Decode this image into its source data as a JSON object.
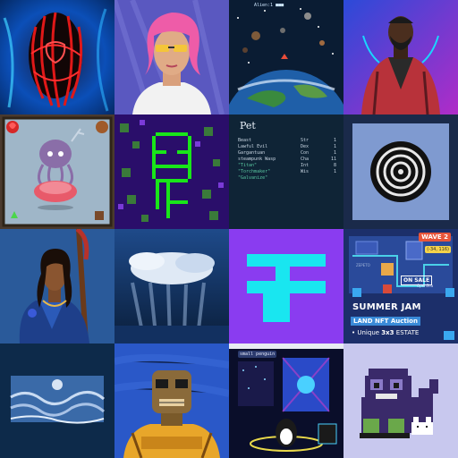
{
  "grid": {
    "tiles": [
      {
        "name": "red-figure-on-blue-artwork"
      },
      {
        "name": "pink-hair-woman-portrait"
      },
      {
        "name": "space-game-screenshot",
        "top_text": "Alien:1 ■■■"
      },
      {
        "name": "man-in-red-jacket-portrait"
      },
      {
        "name": "octopus-creature-card"
      },
      {
        "name": "green-pixel-face-artwork"
      },
      {
        "name": "pet-character-sheet",
        "pet": {
          "title": "Pet",
          "rows": [
            {
              "label": "Beast",
              "stat": "Str",
              "value": "1",
              "highlight": false
            },
            {
              "label": "Lawful Evil",
              "stat": "Dex",
              "value": "1",
              "highlight": false
            },
            {
              "label": "Gargantuan",
              "stat": "Con",
              "value": "1",
              "highlight": false
            },
            {
              "label": "steampunk Wasp",
              "stat": "Cha",
              "value": "11",
              "highlight": false
            },
            {
              "label": "\"Titan\"",
              "stat": "Int",
              "value": "8",
              "highlight": true
            },
            {
              "label": "\"Torchmaker\"",
              "stat": "Wis",
              "value": "1",
              "highlight": true
            },
            {
              "label": "\"Galvanize\"",
              "stat": "",
              "value": "",
              "highlight": true
            }
          ]
        }
      },
      {
        "name": "spiral-disc-artwork"
      },
      {
        "name": "woman-with-staff-illustration"
      },
      {
        "name": "cloudy-sky-painting"
      },
      {
        "name": "cyan-glyph-on-purple"
      },
      {
        "name": "summer-jam-land-auction",
        "estate": {
          "wave": "WAVE 2",
          "coords": "(-34, 116)",
          "zepeto": "ZEPETO",
          "on_sale": "ON SALE",
          "opensea": "OpenSea",
          "summer": "SUMMER JAM",
          "auction": "LAND NFT Auction",
          "bullet": "•",
          "unique_prefix": "Unique ",
          "unique_bold": "3x3",
          "unique_suffix": " ESTATE"
        }
      },
      {
        "name": "underwater-painting"
      },
      {
        "name": "golden-robot-artwork"
      },
      {
        "name": "virtual-world-screenshot",
        "name_tag": "small penguin"
      },
      {
        "name": "pixel-monster-cat-artwork"
      }
    ]
  }
}
